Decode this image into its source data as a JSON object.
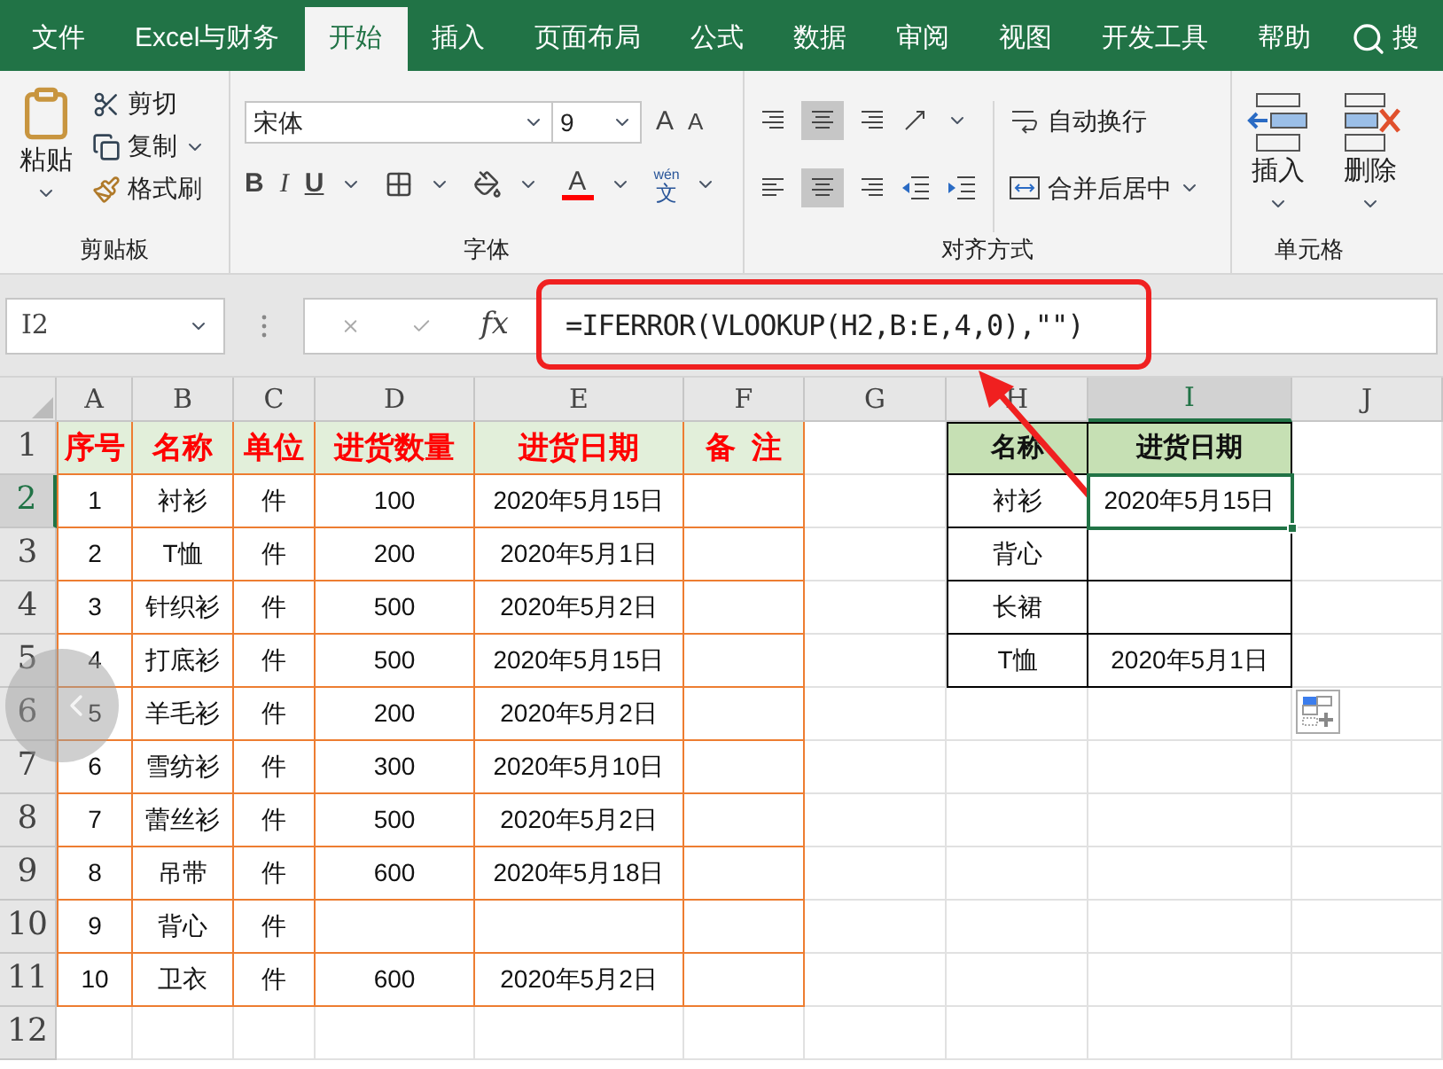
{
  "ribbon_tabs": [
    {
      "label": "文件",
      "selected": false
    },
    {
      "label": "Excel与财务",
      "selected": false
    },
    {
      "label": "开始",
      "selected": true
    },
    {
      "label": "插入",
      "selected": false
    },
    {
      "label": "页面布局",
      "selected": false
    },
    {
      "label": "公式",
      "selected": false
    },
    {
      "label": "数据",
      "selected": false
    },
    {
      "label": "审阅",
      "selected": false
    },
    {
      "label": "视图",
      "selected": false
    },
    {
      "label": "开发工具",
      "selected": false
    },
    {
      "label": "帮助",
      "selected": false
    }
  ],
  "search": {
    "label": "搜"
  },
  "ribbon": {
    "clipboard": {
      "paste": "粘贴",
      "cut": "剪切",
      "copy": "复制",
      "format_painter": "格式刷",
      "label": "剪贴板"
    },
    "font": {
      "name": "宋体",
      "size": "9",
      "grow": "A",
      "shrink": "A",
      "bold": "B",
      "italic": "I",
      "underline": "U",
      "font_color": "A",
      "phonetic_ruby": "wén",
      "phonetic_char": "文",
      "label": "字体"
    },
    "alignment": {
      "wrap": "自动换行",
      "merge": "合并后居中",
      "label": "对齐方式"
    },
    "cells": {
      "insert": "插入",
      "delete": "删除",
      "label": "单元格"
    }
  },
  "formula_bar": {
    "name_box": "I2",
    "fx": "fx",
    "formula": "=IFERROR(VLOOKUP(H2,B:E,4,0),\"\")"
  },
  "columns": [
    {
      "label": "A",
      "selected": false
    },
    {
      "label": "B",
      "selected": false
    },
    {
      "label": "C",
      "selected": false
    },
    {
      "label": "D",
      "selected": false
    },
    {
      "label": "E",
      "selected": false
    },
    {
      "label": "F",
      "selected": false
    },
    {
      "label": "G",
      "selected": false
    },
    {
      "label": "H",
      "selected": false
    },
    {
      "label": "I",
      "selected": true
    },
    {
      "label": "J",
      "selected": false
    }
  ],
  "row_headers": [
    {
      "label": "1",
      "selected": false
    },
    {
      "label": "2",
      "selected": true
    },
    {
      "label": "3",
      "selected": false
    },
    {
      "label": "4",
      "selected": false
    },
    {
      "label": "5",
      "selected": false
    },
    {
      "label": "6",
      "selected": false
    },
    {
      "label": "7",
      "selected": false
    },
    {
      "label": "8",
      "selected": false
    },
    {
      "label": "9",
      "selected": false
    },
    {
      "label": "10",
      "selected": false
    },
    {
      "label": "11",
      "selected": false
    },
    {
      "label": "12",
      "selected": false
    }
  ],
  "main_table": {
    "headers": [
      "序号",
      "名称",
      "单位",
      "进货数量",
      "进货日期",
      "备  注"
    ],
    "rows": [
      {
        "no": "1",
        "name": "衬衫",
        "unit": "件",
        "qty": "100",
        "date": "2020年5月15日"
      },
      {
        "no": "2",
        "name": "T恤",
        "unit": "件",
        "qty": "200",
        "date": "2020年5月1日"
      },
      {
        "no": "3",
        "name": "针织衫",
        "unit": "件",
        "qty": "500",
        "date": "2020年5月2日"
      },
      {
        "no": "4",
        "name": "打底衫",
        "unit": "件",
        "qty": "500",
        "date": "2020年5月15日"
      },
      {
        "no": "5",
        "name": "羊毛衫",
        "unit": "件",
        "qty": "200",
        "date": "2020年5月2日"
      },
      {
        "no": "6",
        "name": "雪纺衫",
        "unit": "件",
        "qty": "300",
        "date": "2020年5月10日"
      },
      {
        "no": "7",
        "name": "蕾丝衫",
        "unit": "件",
        "qty": "500",
        "date": "2020年5月2日"
      },
      {
        "no": "8",
        "name": "吊带",
        "unit": "件",
        "qty": "600",
        "date": "2020年5月18日"
      },
      {
        "no": "9",
        "name": "背心",
        "unit": "件"
      },
      {
        "no": "10",
        "name": "卫衣",
        "unit": "件",
        "qty": "600",
        "date": "2020年5月2日"
      }
    ]
  },
  "lookup_table": {
    "headers": [
      "名称",
      "进货日期"
    ],
    "rows": [
      {
        "name": "衬衫",
        "date": "2020年5月15日",
        "selected": true
      },
      {
        "name": "背心",
        "selected": false
      },
      {
        "name": "长裙",
        "selected": false
      },
      {
        "name": "T恤",
        "date": "2020年5月1日",
        "selected": false
      }
    ]
  }
}
